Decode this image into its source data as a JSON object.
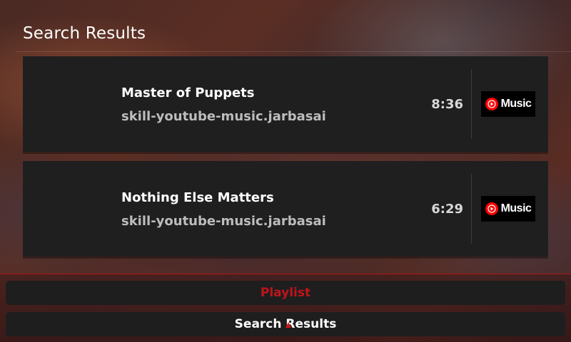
{
  "header": {
    "title": "Search Results"
  },
  "results": [
    {
      "title": "Master of Puppets",
      "source": "skill-youtube-music.jarbasai",
      "duration": "8:36",
      "badge_label": "Music",
      "badge_icon": "youtube-music-icon"
    },
    {
      "title": "Nothing Else Matters",
      "source": "skill-youtube-music.jarbasai",
      "duration": "6:29",
      "badge_label": "Music",
      "badge_icon": "youtube-music-icon"
    }
  ],
  "tabs": {
    "playlist_label": "Playlist",
    "search_results_label": "Search Results"
  },
  "colors": {
    "accent_red": "#c0141c",
    "card_background": "#1f1f1f",
    "youtube_red": "#ff0000"
  }
}
